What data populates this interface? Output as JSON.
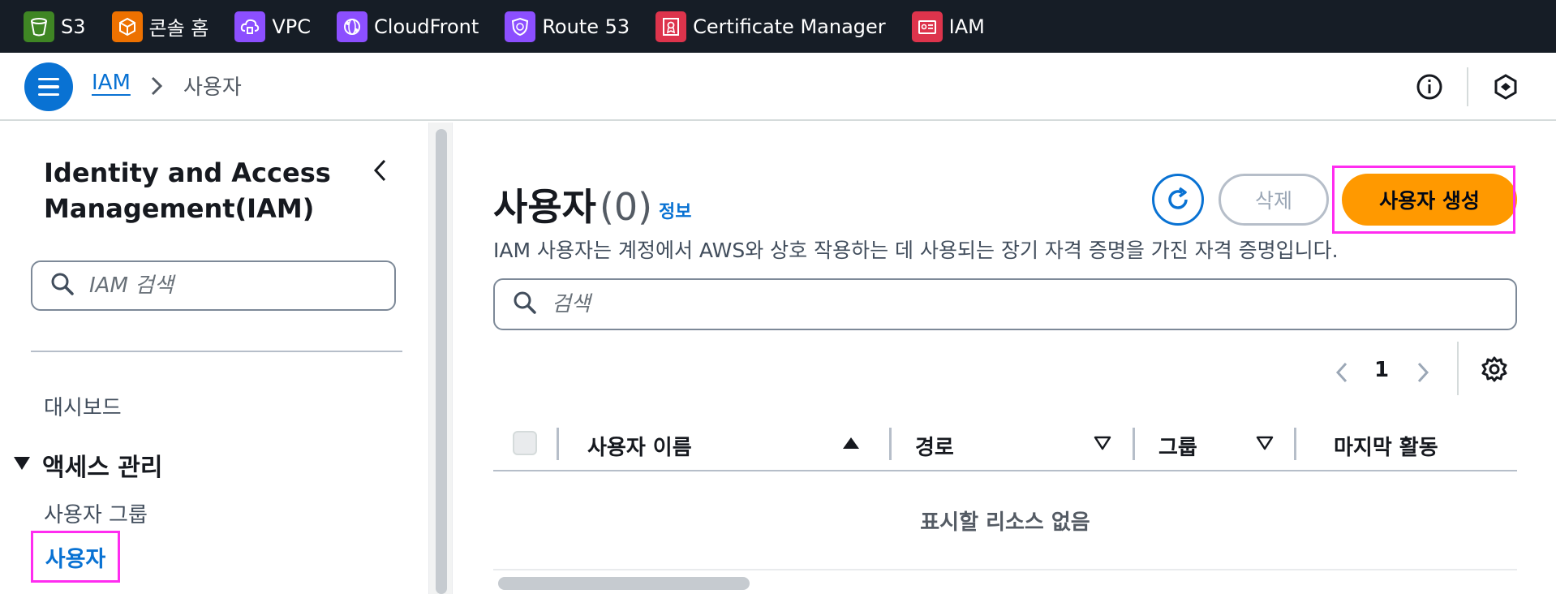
{
  "favorites": [
    {
      "label": "S3",
      "icon": "s3-bucket-icon",
      "color": "#3f8624"
    },
    {
      "label": "콘솔 홈",
      "icon": "console-home-cube-icon",
      "color": "#ed7100"
    },
    {
      "label": "VPC",
      "icon": "vpc-cloud-icon",
      "color": "#8c4fff"
    },
    {
      "label": "CloudFront",
      "icon": "cloudfront-globe-icon",
      "color": "#8c4fff"
    },
    {
      "label": "Route 53",
      "icon": "route53-shield-icon",
      "color": "#8c4fff"
    },
    {
      "label": "Certificate Manager",
      "icon": "certificate-icon",
      "color": "#dd344c"
    },
    {
      "label": "IAM",
      "icon": "iam-badge-icon",
      "color": "#dd344c"
    }
  ],
  "breadcrumb": {
    "root": "IAM",
    "current": "사용자"
  },
  "sidenav": {
    "title": "Identity and Access Management(IAM)",
    "search_placeholder": "IAM 검색",
    "dashboard": "대시보드",
    "section": "액세스 관리",
    "user_groups": "사용자 그룹",
    "users": "사용자"
  },
  "main": {
    "title": "사용자",
    "count": "(0)",
    "info": "정보",
    "description": "IAM 사용자는 계정에서 AWS와 상호 작용하는 데 사용되는 장기 자격 증명을 가진 자격 증명입니다.",
    "delete_label": "삭제",
    "create_label": "사용자 생성",
    "search_placeholder": "검색",
    "page": "1",
    "columns": [
      "사용자 이름",
      "경로",
      "그룹",
      "마지막 활동"
    ],
    "empty": "표시할 리소스 없음"
  },
  "colors": {
    "accent": "#0972d3",
    "primary_button": "#ff9900",
    "highlight": "#ff2cf0",
    "topbar": "#161d26"
  }
}
